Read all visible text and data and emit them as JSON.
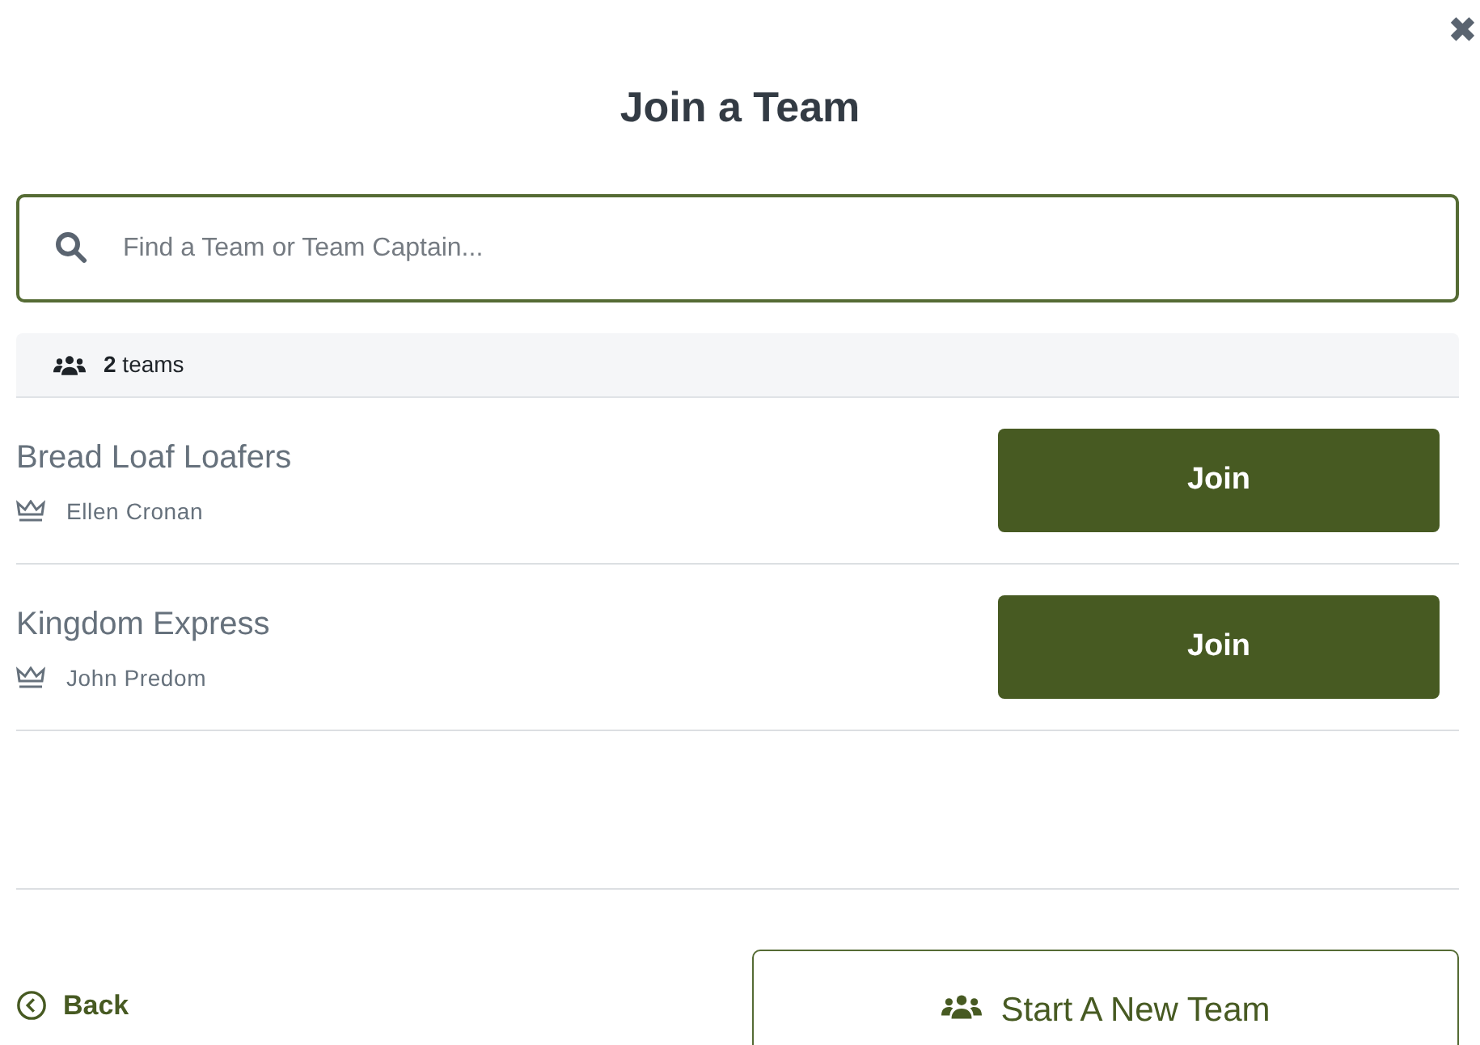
{
  "close": {
    "label": "✖"
  },
  "title": "Join a Team",
  "search": {
    "placeholder": "Find a Team or Team Captain..."
  },
  "count": "**2** teams",
  "teams": [
    {
      "name": "Bread Loaf Loafers",
      "captain": "Ellen Cronan",
      "button": "Join"
    },
    {
      "name": "Kingdom Express",
      "captain": "John Predom",
      "button": "Join"
    }
  ],
  "footer": {
    "back": "Back",
    "start": "Start A New Team"
  }
}
